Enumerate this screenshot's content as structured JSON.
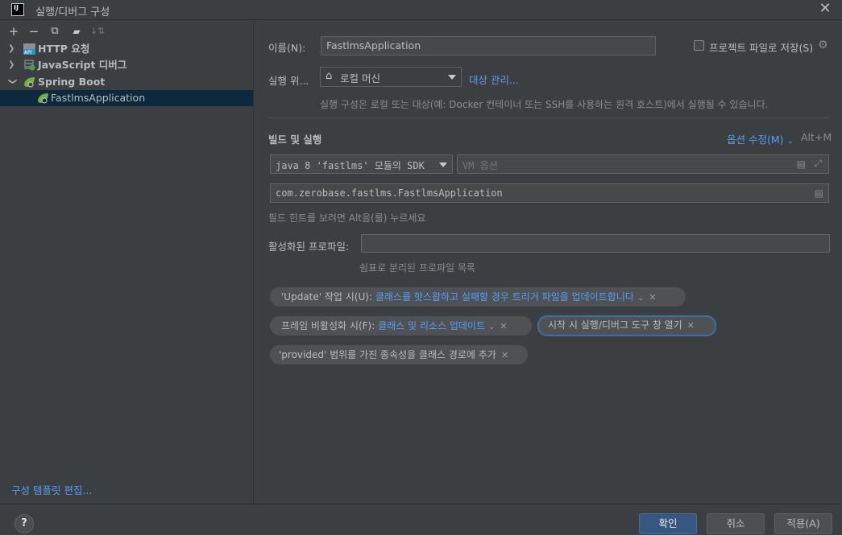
{
  "window": {
    "logo_text": "IJ",
    "title": "실행/디버그 구성",
    "close_glyph": "✕"
  },
  "toolbar": {
    "add": "+",
    "remove": "−",
    "copy": "⧉",
    "folder": "▰",
    "sort": "↓⇅"
  },
  "tree": {
    "items": [
      {
        "label": "HTTP 요청"
      },
      {
        "label": "JavaScript 디버그"
      },
      {
        "label": "Spring Boot"
      },
      {
        "label": "FastlmsApplication"
      }
    ]
  },
  "left_footer": {
    "edit_templates": "구성 템플릿 편집..."
  },
  "form": {
    "name_label": "이름(N):",
    "name_value": "FastlmsApplication",
    "store_as_file_label": "프로젝트 파일로 저장(S)",
    "run_on_label": "실행 위...",
    "run_on_value": "로컬 머신",
    "manage_targets": "대상 관리...",
    "run_on_hint": "실행 구성은 로컬 또는 대상(예: Docker 컨테이너 또는 SSH를 사용하는 원격 호스트)에서 실행될 수 있습니다.",
    "build_run_title": "빌드 및 실행",
    "modify_options": "옵션 수정(M)",
    "modify_shortcut": "Alt+M",
    "sdk_value": "java 8 'fastlms' 모듈의 SDK",
    "vm_options_placeholder": "VM 옵션",
    "main_class": "com.zerobase.fastlms.FastlmsApplication",
    "field_hint": "필드 힌트를 보려면 Alt을(를) 누르세요",
    "active_profiles_label": "활성화된 프로파일:",
    "active_profiles_value": "",
    "active_profiles_hint": "쉼표로 분리된 프로파일 목록"
  },
  "chips": [
    {
      "prefix": "'Update' 작업 시(U):",
      "link": "클래스를 핫스왑하고 실패할 경우 트리거 파일을 업데이트합니다",
      "chevron": "⌄",
      "x": "✕"
    },
    {
      "prefix": "프레임 비활성화 시(F):",
      "link": "클래스 및 리소스 업데이트",
      "chevron": "⌄",
      "x": "✕"
    },
    {
      "prefix": "시작 시 실행/디버그 도구 창 열기",
      "link": "",
      "chevron": "",
      "x": "✕"
    },
    {
      "prefix": "'provided' 범위를 가진 종속성을 클래스 경로에 추가",
      "link": "",
      "chevron": "",
      "x": "✕"
    }
  ],
  "buttons": {
    "help": "?",
    "ok": "확인",
    "cancel": "취소",
    "apply": "적용(A)"
  },
  "colors": {
    "background": "#3c3f41",
    "accent_link": "#589df6",
    "selection": "#0d293e",
    "primary_button": "#365880"
  }
}
